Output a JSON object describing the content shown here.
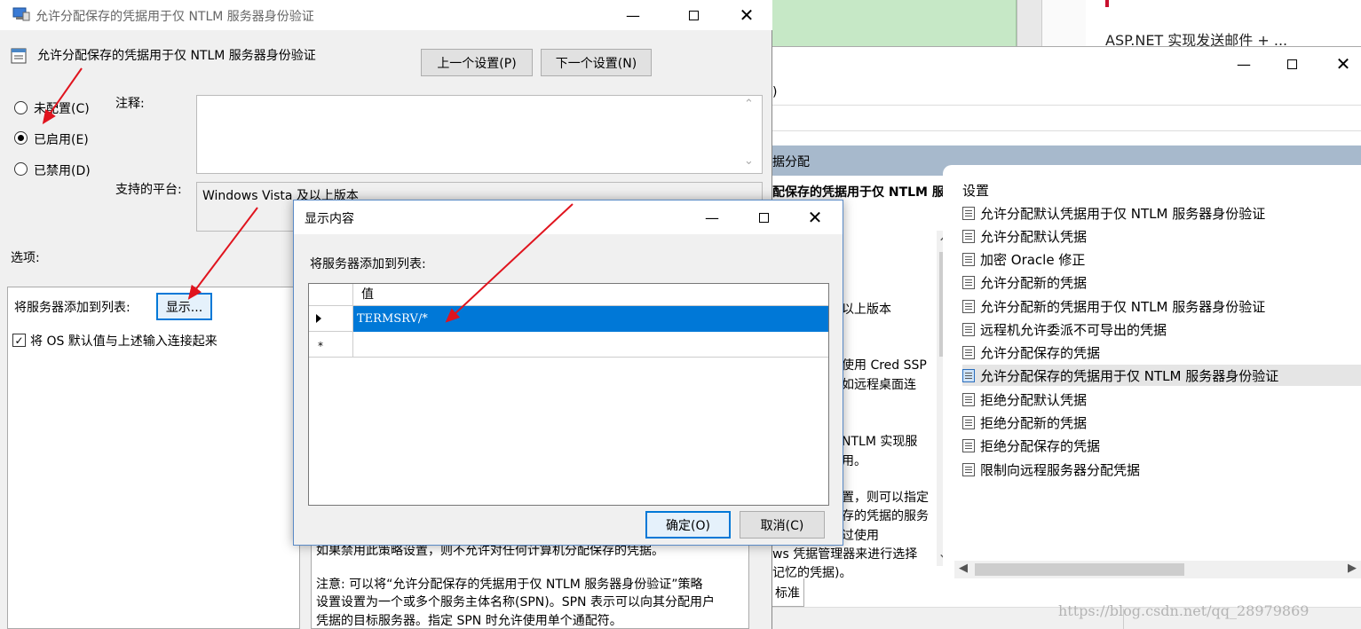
{
  "back_window": {
    "top_caption_link": "ASP.NET 实现发送邮件 + ...",
    "paren": ")",
    "breadcrumb": "据分配",
    "setting_title_partial": "配保存的凭据用于仅 NTLM 服",
    "desc_lines": [
      "以上版本",
      "使用 Cred SSP",
      "如远程桌面连",
      "NTLM 实现服",
      "用。",
      "置，则可以指定",
      "存的凭据的服务",
      "过使用",
      "ws 凭据管理器来进行选择",
      "记忆的凭据)。"
    ],
    "tab_label": "标准",
    "list_header": "设置",
    "list_items": [
      "允许分配默认凭据用于仅 NTLM 服务器身份验证",
      "允许分配默认凭据",
      "加密 Oracle 修正",
      "允许分配新的凭据",
      "允许分配新的凭据用于仅 NTLM 服务器身份验证",
      "远程机允许委派不可导出的凭据",
      "允许分配保存的凭据",
      "允许分配保存的凭据用于仅 NTLM 服务器身份验证",
      "拒绝分配默认凭据",
      "拒绝分配新的凭据",
      "拒绝分配保存的凭据",
      "限制向远程服务器分配凭据"
    ],
    "selected_index": 7
  },
  "policy_window": {
    "title": "允许分配保存的凭据用于仅 NTLM 服务器身份验证",
    "heading": "允许分配保存的凭据用于仅 NTLM 服务器身份验证",
    "prev_button": "上一个设置(P)",
    "next_button": "下一个设置(N)",
    "radio_not_configured": "未配置(C)",
    "radio_enabled": "已启用(E)",
    "radio_disabled": "已禁用(D)",
    "selected_radio": "enabled",
    "comment_label": "注释:",
    "platform_label": "支持的平台:",
    "platform_value": "Windows Vista 及以上版本",
    "options_label": "选项:",
    "add_servers_label": "将服务器添加到列表:",
    "show_button": "显示...",
    "concat_checkbox_label": "将 OS 默认值与上述输入连接起来",
    "concat_checked": true,
    "help_line1": "如果禁用此策略设置，则不允许对任何计算机分配保存的凭据。",
    "help_line2": "注意: 可以将“允许分配保存的凭据用于仅 NTLM 服务器身份验证”策略",
    "help_line3": "设置设置为一个或多个服务主体名称(SPN)。SPN 表示可以向其分配用户",
    "help_line4": "凭据的目标服务器。指定 SPN 时允许使用单个通配符。"
  },
  "show_dialog": {
    "title": "显示内容",
    "prompt": "将服务器添加到列表:",
    "column_header": "值",
    "rows": [
      "TERMSRV/*"
    ],
    "new_row_marker": "*",
    "ok_button": "确定(O)",
    "cancel_button": "取消(C)"
  },
  "watermark": "https://blog.csdn.net/qq_28979869",
  "colors": {
    "selection_blue": "#0078d7",
    "header_band": "#a7b9cc",
    "arrow_red": "#e0141e",
    "green_strip": "#c6e8c6"
  }
}
